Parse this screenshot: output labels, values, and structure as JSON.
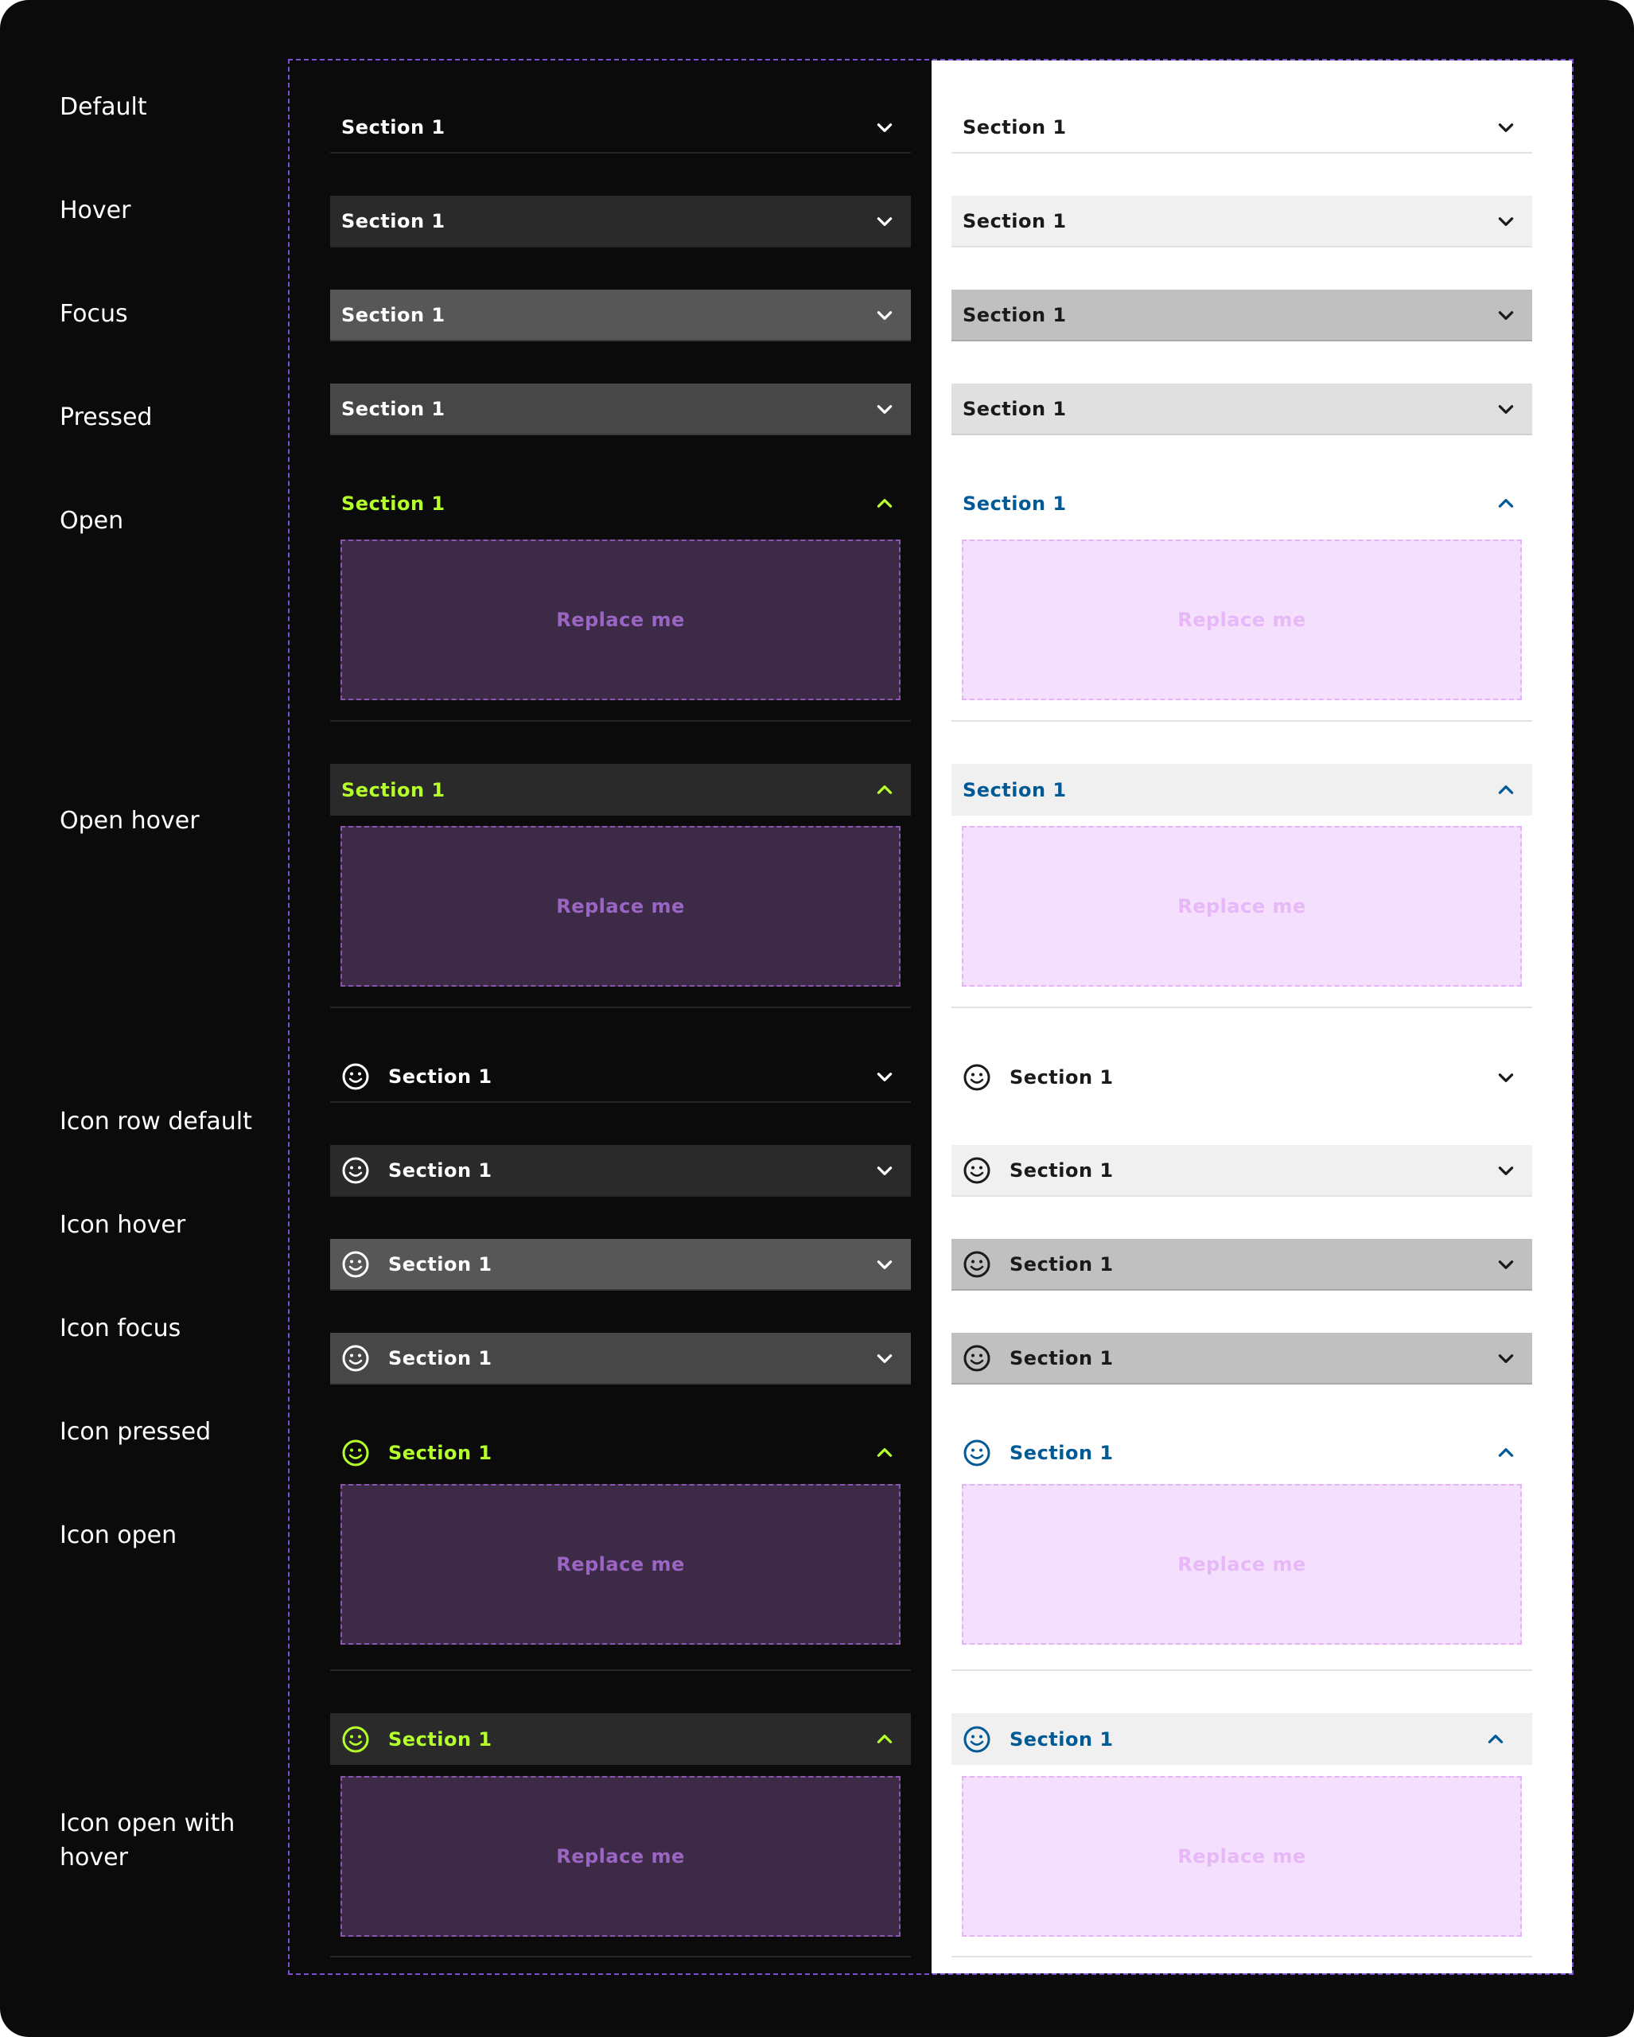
{
  "colors": {
    "canvas": "#0b0b0b",
    "panel_border": "#7a4fd6",
    "dark_open_accent": "#b5ff2b",
    "light_open_accent": "#005a96",
    "dark_slot_bg": "#3d2a47",
    "light_slot_bg": "#f4e0fd"
  },
  "state_labels": [
    "Default",
    "Hover",
    "Focus",
    "Pressed",
    "Open",
    "Open hover",
    "Icon row default",
    "Icon hover",
    "Icon focus",
    "Icon pressed",
    "Icon open",
    "Icon open with",
    "hover"
  ],
  "accordion": {
    "section_label": "Section 1",
    "slot_text": "Replace me",
    "leading_icon": "smiley-face-icon",
    "collapsed_icon": "chevron-down-icon",
    "expanded_icon": "chevron-up-icon"
  }
}
